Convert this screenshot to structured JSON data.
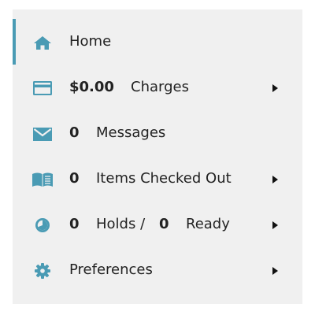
{
  "colors": {
    "accent": "#4a9bb4",
    "icon": "#4a9bb4",
    "panel_bg": "#f0f0f0",
    "text": "#222222"
  },
  "menu": {
    "home": {
      "label": "Home",
      "icon": "home-icon",
      "active": true
    },
    "charges": {
      "amount": "$0.00",
      "label": "Charges",
      "icon": "credit-card-icon",
      "has_submenu": true
    },
    "messages": {
      "count": "0",
      "label": "Messages",
      "icon": "envelope-icon"
    },
    "checked_out": {
      "count": "0",
      "label": "Items Checked Out",
      "icon": "open-book-icon",
      "has_submenu": true
    },
    "holds": {
      "holds_count": "0",
      "holds_label": "Holds /",
      "ready_count": "0",
      "ready_label": "Ready",
      "icon": "clock-icon",
      "has_submenu": true
    },
    "preferences": {
      "label": "Preferences",
      "icon": "gear-icon",
      "has_submenu": true
    }
  }
}
